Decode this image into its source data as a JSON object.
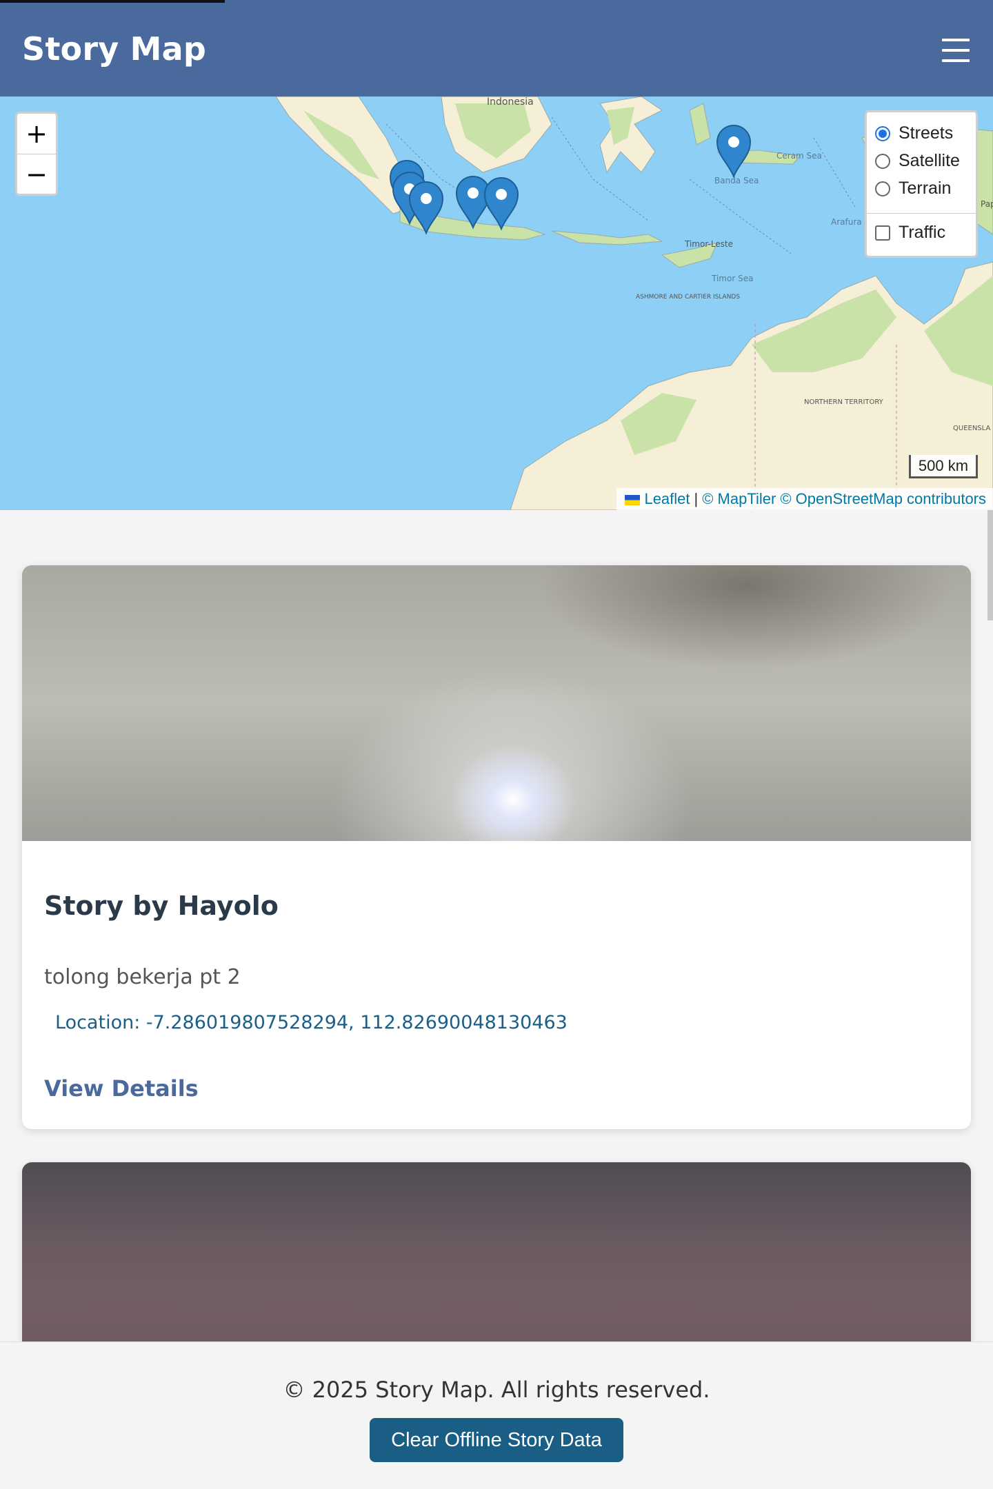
{
  "header": {
    "title": "Story Map",
    "menu_icon": "hamburger-menu-icon"
  },
  "map": {
    "zoom_in_label": "+",
    "zoom_out_label": "−",
    "layers": {
      "base_options": [
        {
          "label": "Streets",
          "selected": true
        },
        {
          "label": "Satellite",
          "selected": false
        },
        {
          "label": "Terrain",
          "selected": false
        }
      ],
      "overlay_options": [
        {
          "label": "Traffic",
          "checked": false
        }
      ]
    },
    "scale_label": "500 km",
    "attribution": {
      "leaflet": "Leaflet",
      "separator": "|",
      "maptiler": "© MapTiler",
      "osm": "© OpenStreetMap contributors"
    },
    "place_labels": [
      "Indonesia",
      "Banda Sea",
      "Ceram Sea",
      "Arafura Sea",
      "Timor-Leste",
      "Timor Sea",
      "ASHMORE AND CARTIER ISLANDS",
      "NORTHERN TERRITORY",
      "QUEENSLA",
      "Papu Gu"
    ],
    "marker_icon": "map-pin-icon",
    "colors": {
      "water": "#8ecff6",
      "land": "#f4efd6",
      "green": "#c9e2a8",
      "marker": "#2f86cc"
    }
  },
  "stories": [
    {
      "title": "Story by Hayolo",
      "description": "tolong bekerja pt 2",
      "location": "Location: -7.286019807528294, 112.82690048130463",
      "link": "View Details"
    }
  ],
  "footer": {
    "copyright": "© 2025 Story Map. All rights reserved.",
    "clear_button": "Clear Offline Story Data"
  },
  "colors": {
    "header": "#4a6a9e",
    "button": "#1b5e85",
    "link": "#4a6a9e",
    "location": "#1a5f88"
  }
}
